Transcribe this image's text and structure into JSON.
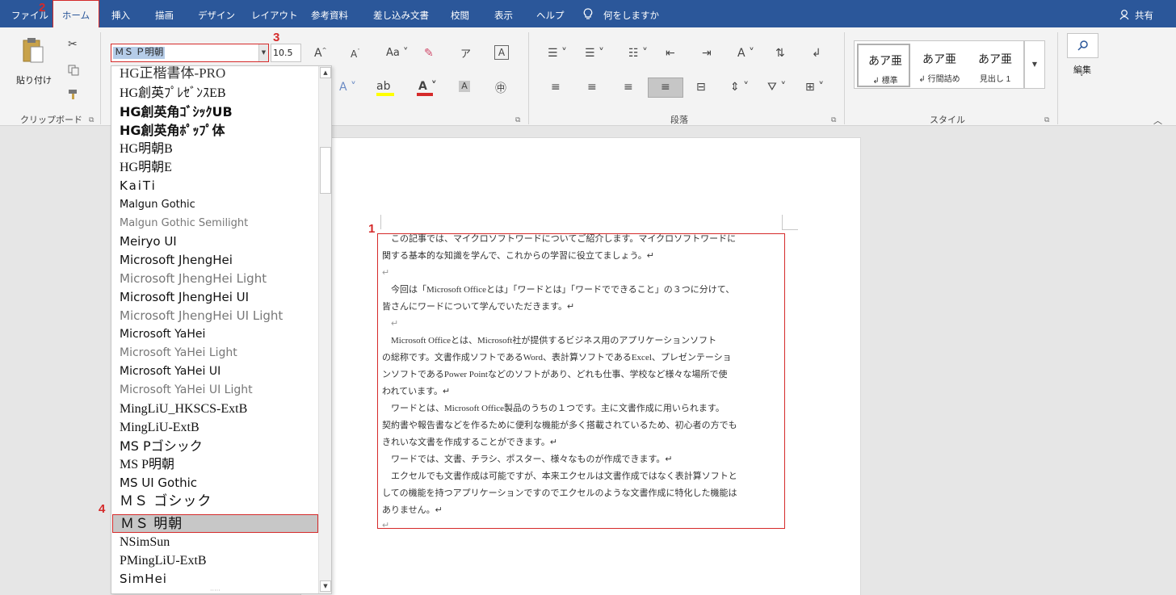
{
  "menu": {
    "tabs": [
      "ファイル",
      "ホーム",
      "挿入",
      "描画",
      "デザイン",
      "レイアウト",
      "参考資料",
      "差し込み文書",
      "校閲",
      "表示",
      "ヘルプ"
    ],
    "tell_me": "何をしますか",
    "share": "共有"
  },
  "annotations": {
    "n1": "1",
    "n2": "2",
    "n3": "3",
    "n4": "4"
  },
  "ribbon": {
    "clipboard": {
      "paste": "貼り付け",
      "label": "クリップボード"
    },
    "font": {
      "name_value": "ＭＳ Ｐ明朝",
      "size_value": "10.5"
    },
    "paragraph": {
      "label": "段落"
    },
    "styles": {
      "label": "スタイル",
      "items": [
        {
          "preview": "あア亜",
          "name": "↲ 標準"
        },
        {
          "preview": "あア亜",
          "name": "↲ 行間詰め"
        },
        {
          "preview": "あア亜",
          "name": "見出し 1"
        }
      ]
    },
    "editing": {
      "label": "編集"
    }
  },
  "font_list": [
    "HG正楷書体-PRO",
    "HG創英ﾌﾟﾚｾﾞﾝｽEB",
    "HG創英角ｺﾞｼｯｸUB",
    "HG創英角ﾎﾟｯﾌﾟ体",
    "HG明朝B",
    "HG明朝E",
    "KaiTi",
    "Malgun Gothic",
    "Malgun Gothic Semilight",
    "Meiryo UI",
    "Microsoft JhengHei",
    "Microsoft JhengHei Light",
    "Microsoft JhengHei UI",
    "Microsoft JhengHei UI Light",
    "Microsoft YaHei",
    "Microsoft YaHei Light",
    "Microsoft YaHei UI",
    "Microsoft YaHei UI Light",
    "MingLiU_HKSCS-ExtB",
    "MingLiU-ExtB",
    "MS Pゴシック",
    "MS P明朝",
    "MS UI Gothic",
    "ＭＳ ゴシック",
    "ＭＳ 明朝",
    "NSimSun",
    "PMingLiU-ExtB",
    "SimHei"
  ],
  "document": {
    "lines": [
      "　この記事では、マイクロソフトワードについてご紹介します。マイクロソフトワードに",
      "関する基本的な知識を学んで、これからの学習に役立てましょう。↵",
      "↵",
      "　今回は「Microsoft Officeとは」「ワードとは」「ワードでできること」の３つに分けて、",
      "皆さんにワードについて学んでいただきます。↵",
      "　↵",
      "　Microsoft Officeとは、Microsoft社が提供するビジネス用のアプリケーションソフト",
      "の総称です。文書作成ソフトであるWord、表計算ソフトであるExcel、プレゼンテーショ",
      "ンソフトであるPower Pointなどのソフトがあり、どれも仕事、学校など様々な場所で使",
      "われています。↵",
      "　ワードとは、Microsoft Office製品のうちの１つです。主に文書作成に用いられます。",
      "契約書や報告書などを作るために便利な機能が多く搭載されているため、初心者の方でも",
      "きれいな文書を作成することができます。↵",
      "　ワードでは、文書、チラシ、ポスター、様々なものが作成できます。↵",
      "　エクセルでも文書作成は可能ですが、本来エクセルは文書作成ではなく表計算ソフトと",
      "しての機能を持つアプリケーションですのでエクセルのような文書作成に特化した機能は",
      "ありません。↵",
      "↵"
    ]
  }
}
